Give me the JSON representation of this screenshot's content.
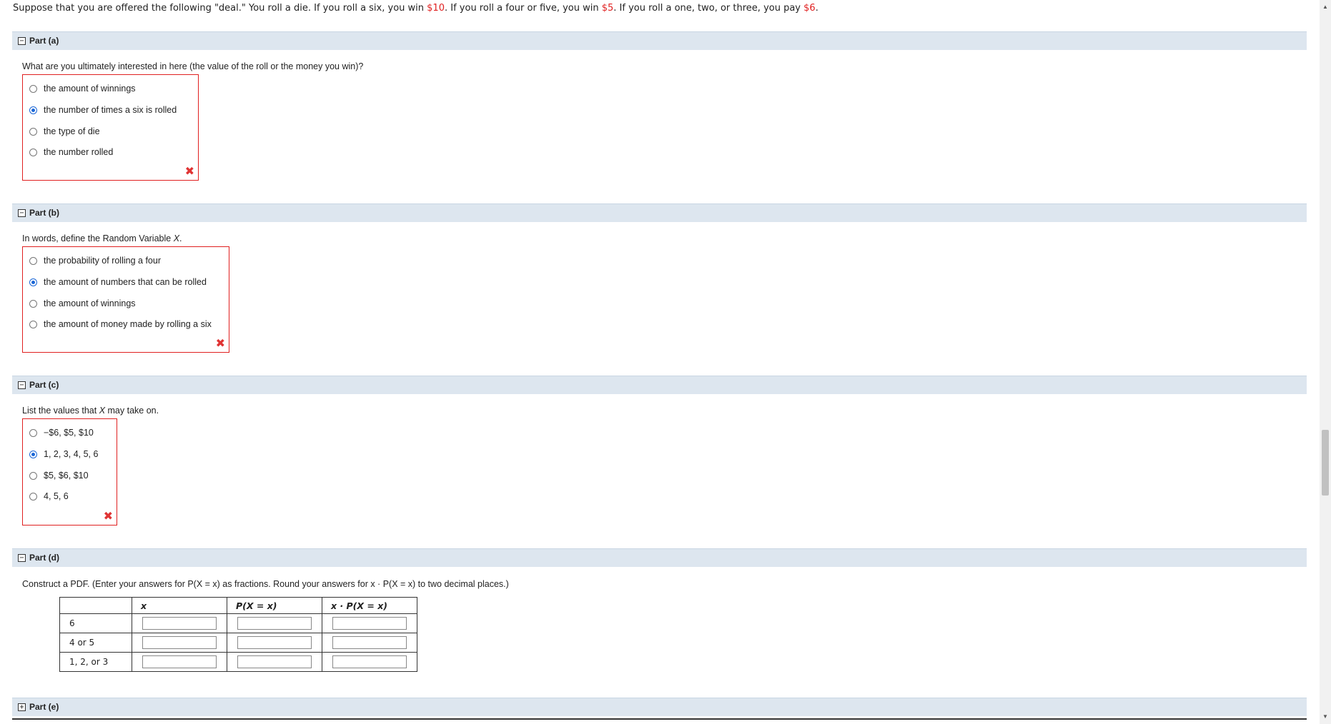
{
  "prompt": {
    "t1": "Suppose that you are offered the following \"deal.\" You roll a die. If you roll a six, you win ",
    "m1": "$10",
    "t2": ". If you roll a four or five, you win ",
    "m2": "$5",
    "t3": ". If you roll a one, two, or three, you pay ",
    "m3": "$6",
    "t4": "."
  },
  "part_a": {
    "toggle": "−",
    "label": "Part (a)",
    "question": "What are you ultimately interested in here (the value of the roll or the money you win)?",
    "options": [
      "the amount of winnings",
      "the number of times a six is rolled",
      "the type of die",
      "the number rolled"
    ],
    "selected_index": 1,
    "status": "✖"
  },
  "part_b": {
    "toggle": "−",
    "label": "Part (b)",
    "question_pre": "In words, define the Random Variable ",
    "question_var": "X",
    "question_post": ".",
    "options": [
      "the probability of rolling a four",
      "the amount of numbers that can be rolled",
      "the amount of winnings",
      "the amount of money made by rolling a six"
    ],
    "selected_index": 1,
    "status": "✖"
  },
  "part_c": {
    "toggle": "−",
    "label": "Part (c)",
    "question_pre": "List the values that ",
    "question_var": "X",
    "question_post": " may take on.",
    "options": [
      "−$6, $5, $10",
      "1, 2, 3, 4, 5, 6",
      "$5, $6, $10",
      "4, 5, 6"
    ],
    "selected_index": 1,
    "status": "✖"
  },
  "part_d": {
    "toggle": "−",
    "label": "Part (d)",
    "question": "Construct a PDF. (Enter your answers for P(X = x) as fractions. Round your answers for x · P(X = x) to two decimal places.)",
    "table": {
      "headers": [
        "",
        "x",
        "P(X = x)",
        "x · P(X = x)"
      ],
      "rows": [
        "6",
        "4 or 5",
        "1, 2, or 3"
      ]
    }
  },
  "part_e": {
    "toggle": "+",
    "label": "Part (e)"
  }
}
